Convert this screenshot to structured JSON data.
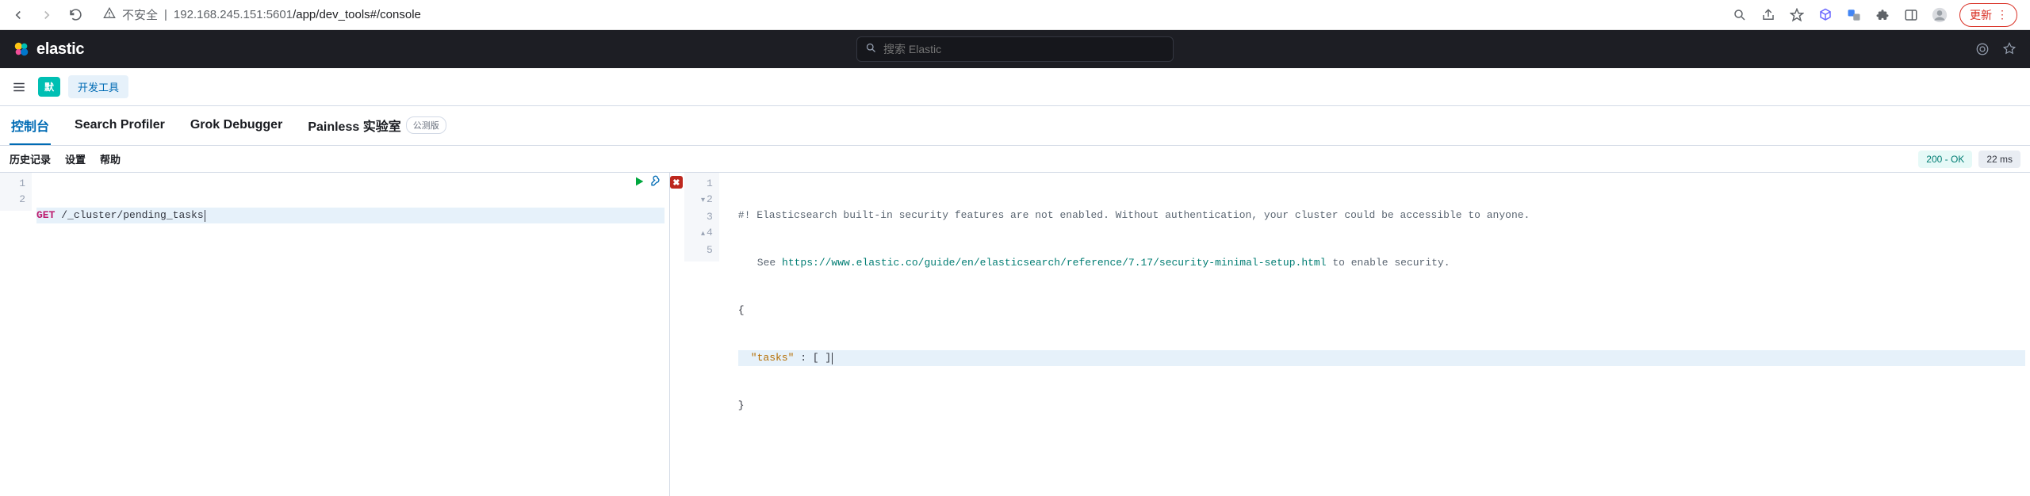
{
  "chrome": {
    "security_label": "不安全",
    "url_host": "192.168.245.151:5601",
    "url_path": "/app/dev_tools#/console",
    "update_label": "更新"
  },
  "header": {
    "brand": "elastic",
    "search_placeholder": "搜索 Elastic"
  },
  "secondary_nav": {
    "badge": "默",
    "app_label": "开发工具"
  },
  "tabs": {
    "console": "控制台",
    "profiler": "Search Profiler",
    "grok": "Grok Debugger",
    "painless": "Painless 实验室",
    "painless_beta": "公测版"
  },
  "toolbar": {
    "history": "历史记录",
    "settings": "设置",
    "help": "帮助",
    "status": "200 - OK",
    "timing": "22 ms"
  },
  "request": {
    "method": "GET",
    "path": "/_cluster/pending_tasks",
    "gutter": [
      "1",
      "2"
    ]
  },
  "response": {
    "gutter": [
      "1",
      "2",
      "3",
      "4",
      "5"
    ],
    "comment_prefix": "#! ",
    "comment_l1": "Elasticsearch built-in security features are not enabled. Without authentication, your cluster could be accessible to anyone.",
    "comment_see": "See ",
    "comment_url": "https://www.elastic.co/guide/en/elasticsearch/reference/7.17/security-minimal-setup.html",
    "comment_tail": " to enable security.",
    "brace_open": "{",
    "tasks_key": "\"tasks\"",
    "tasks_glue": " : [ ]",
    "brace_close": "}"
  }
}
